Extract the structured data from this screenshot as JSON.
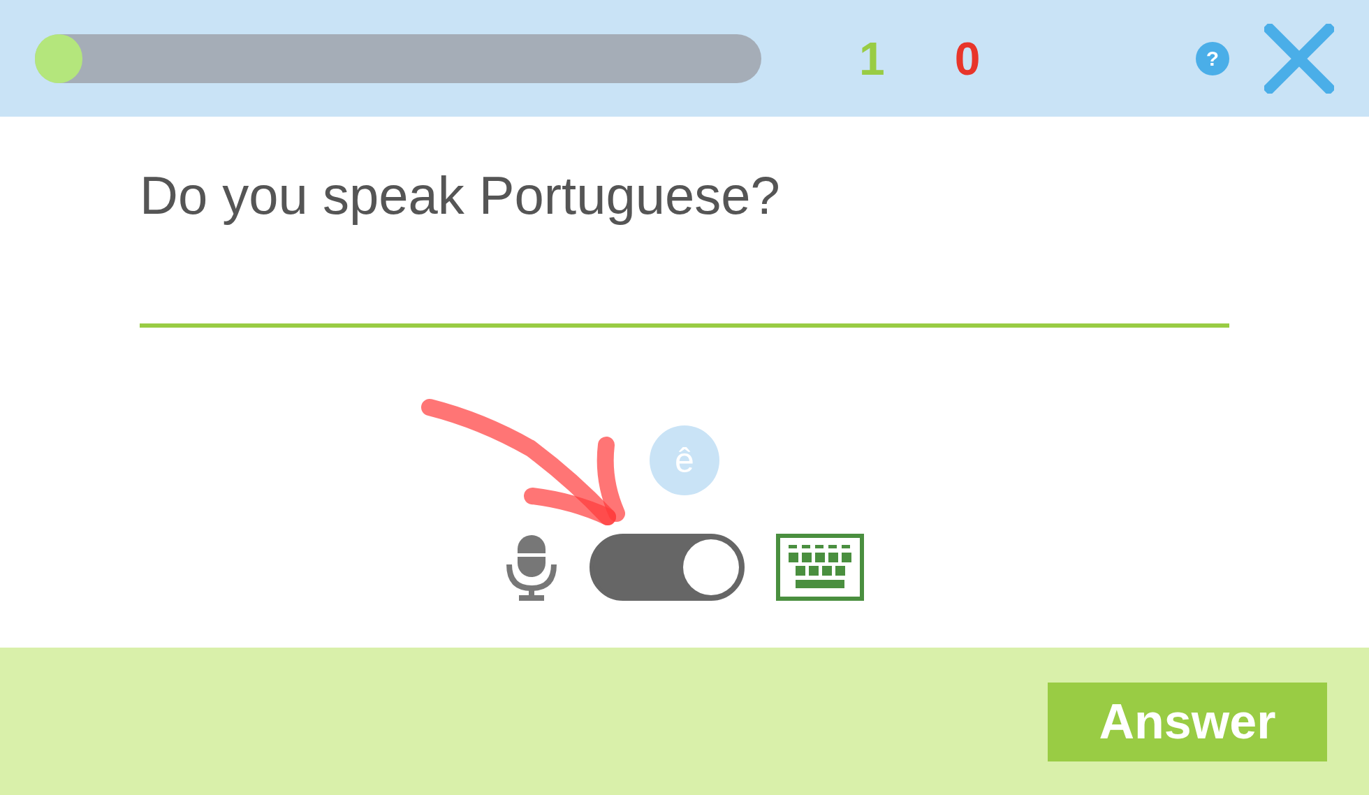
{
  "progress": {
    "level": 0.065
  },
  "scores": [
    {
      "kind": "correct",
      "value": "1"
    },
    {
      "kind": "wrong",
      "value": "0"
    }
  ],
  "help": {
    "label": "?"
  },
  "question": "Do you speak Portuguese?",
  "accent_key": "ê",
  "input_mode_toggle": {
    "on": true
  },
  "answer_button": "Answer"
}
